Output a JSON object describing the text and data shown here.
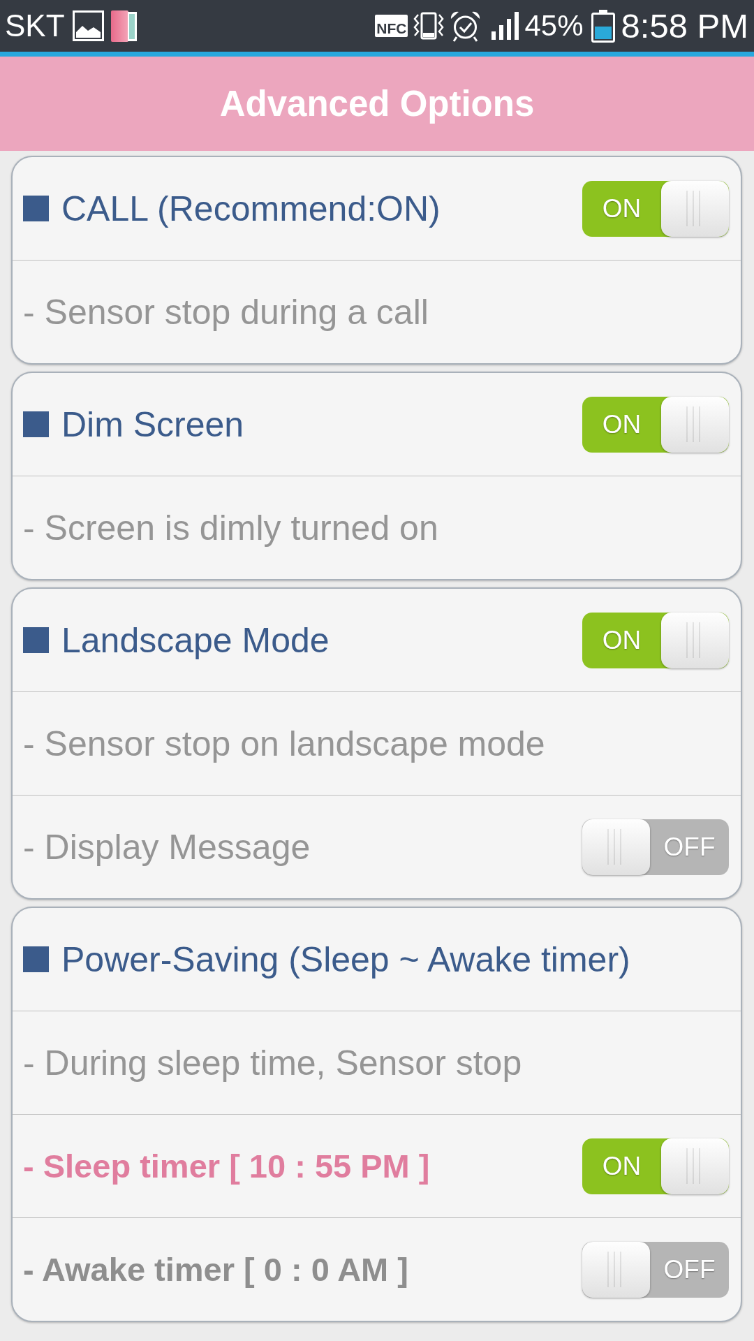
{
  "status_bar": {
    "carrier": "SKT",
    "nfc": "NFC",
    "battery": "45%",
    "time": "8:58 PM"
  },
  "header": {
    "title": "Advanced Options"
  },
  "sections": [
    {
      "title": "CALL (Recommend:ON)",
      "switch": {
        "on": true,
        "label": "ON"
      },
      "rows": [
        {
          "kind": "note",
          "text": "- Sensor stop during a call"
        }
      ]
    },
    {
      "title": "Dim Screen",
      "switch": {
        "on": true,
        "label": "ON"
      },
      "rows": [
        {
          "kind": "note",
          "text": "- Screen is dimly turned on"
        }
      ]
    },
    {
      "title": "Landscape Mode",
      "switch": {
        "on": true,
        "label": "ON"
      },
      "rows": [
        {
          "kind": "note",
          "text": "- Sensor stop on landscape mode"
        },
        {
          "kind": "note",
          "text": "- Display Message",
          "switch": {
            "on": false,
            "label": "OFF"
          }
        }
      ]
    },
    {
      "title": "Power-Saving (Sleep ~ Awake timer)",
      "rows": [
        {
          "kind": "note",
          "text": "- During sleep time, Sensor stop"
        },
        {
          "kind": "timer",
          "text": "- Sleep timer [ 10 : 55 PM ]",
          "switch": {
            "on": true,
            "label": "ON"
          }
        },
        {
          "kind": "timer",
          "text": "- Awake timer [ 0 : 0 AM ]",
          "switch": {
            "on": false,
            "label": "OFF"
          }
        }
      ]
    }
  ]
}
